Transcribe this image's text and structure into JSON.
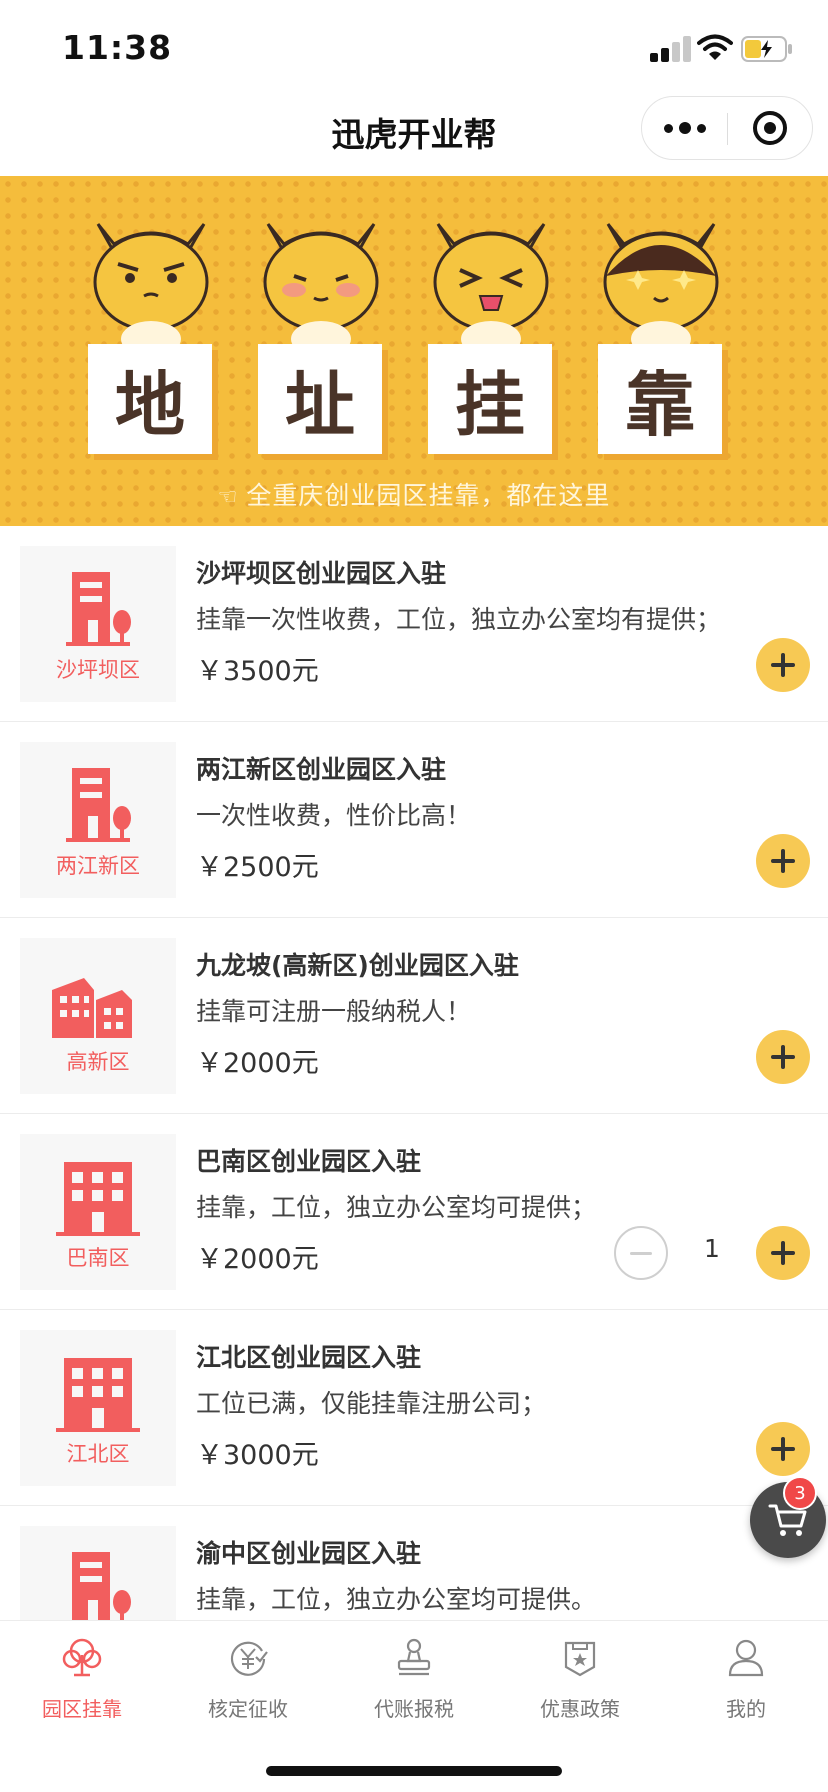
{
  "status_bar": {
    "time": "11:38"
  },
  "nav": {
    "title": "迅虎开业帮"
  },
  "banner": {
    "tiles": [
      "地",
      "址",
      "挂",
      "靠"
    ],
    "caption": "全重庆创业园区挂靠，都在这里"
  },
  "listings": [
    {
      "title": "沙坪坝区创业园区入驻",
      "desc": "挂靠一次性收费，工位，独立办公室均有提供；",
      "price": "￥3500元",
      "thumb_label": "沙坪坝区",
      "icon": "building-with-tree-icon"
    },
    {
      "title": "两江新区创业园区入驻",
      "desc": "一次性收费，性价比高！",
      "price": "￥2500元",
      "thumb_label": "两江新区",
      "icon": "building-with-tree-icon"
    },
    {
      "title": "九龙坡(高新区)创业园区入驻",
      "desc": "挂靠可注册一般纳税人！",
      "price": "￥2000元",
      "thumb_label": "高新区",
      "icon": "city-buildings-icon"
    },
    {
      "title": "巴南区创业园区入驻",
      "desc": "挂靠，工位，独立办公室均可提供；",
      "price": "￥2000元",
      "thumb_label": "巴南区",
      "icon": "office-building-icon",
      "quantity": "1"
    },
    {
      "title": "江北区创业园区入驻",
      "desc": "工位已满，仅能挂靠注册公司；",
      "price": "￥3000元",
      "thumb_label": "江北区",
      "icon": "office-building-icon"
    },
    {
      "title": "渝中区创业园区入驻",
      "desc": "挂靠，工位，独立办公室均可提供。",
      "icon": "building-with-tree-icon"
    }
  ],
  "cart": {
    "badge": "3"
  },
  "tabs": [
    {
      "label": "园区挂靠",
      "icon": "park-tree-icon",
      "active": true
    },
    {
      "label": "核定征收",
      "icon": "yen-check-icon"
    },
    {
      "label": "代账报税",
      "icon": "stamp-icon"
    },
    {
      "label": "优惠政策",
      "icon": "policy-badge-icon"
    },
    {
      "label": "我的",
      "icon": "user-icon"
    }
  ],
  "colors": {
    "accent": "#f25e5e",
    "add_button": "#f7c954",
    "banner": "#f5bd3c",
    "tile_text": "#4a3428"
  }
}
